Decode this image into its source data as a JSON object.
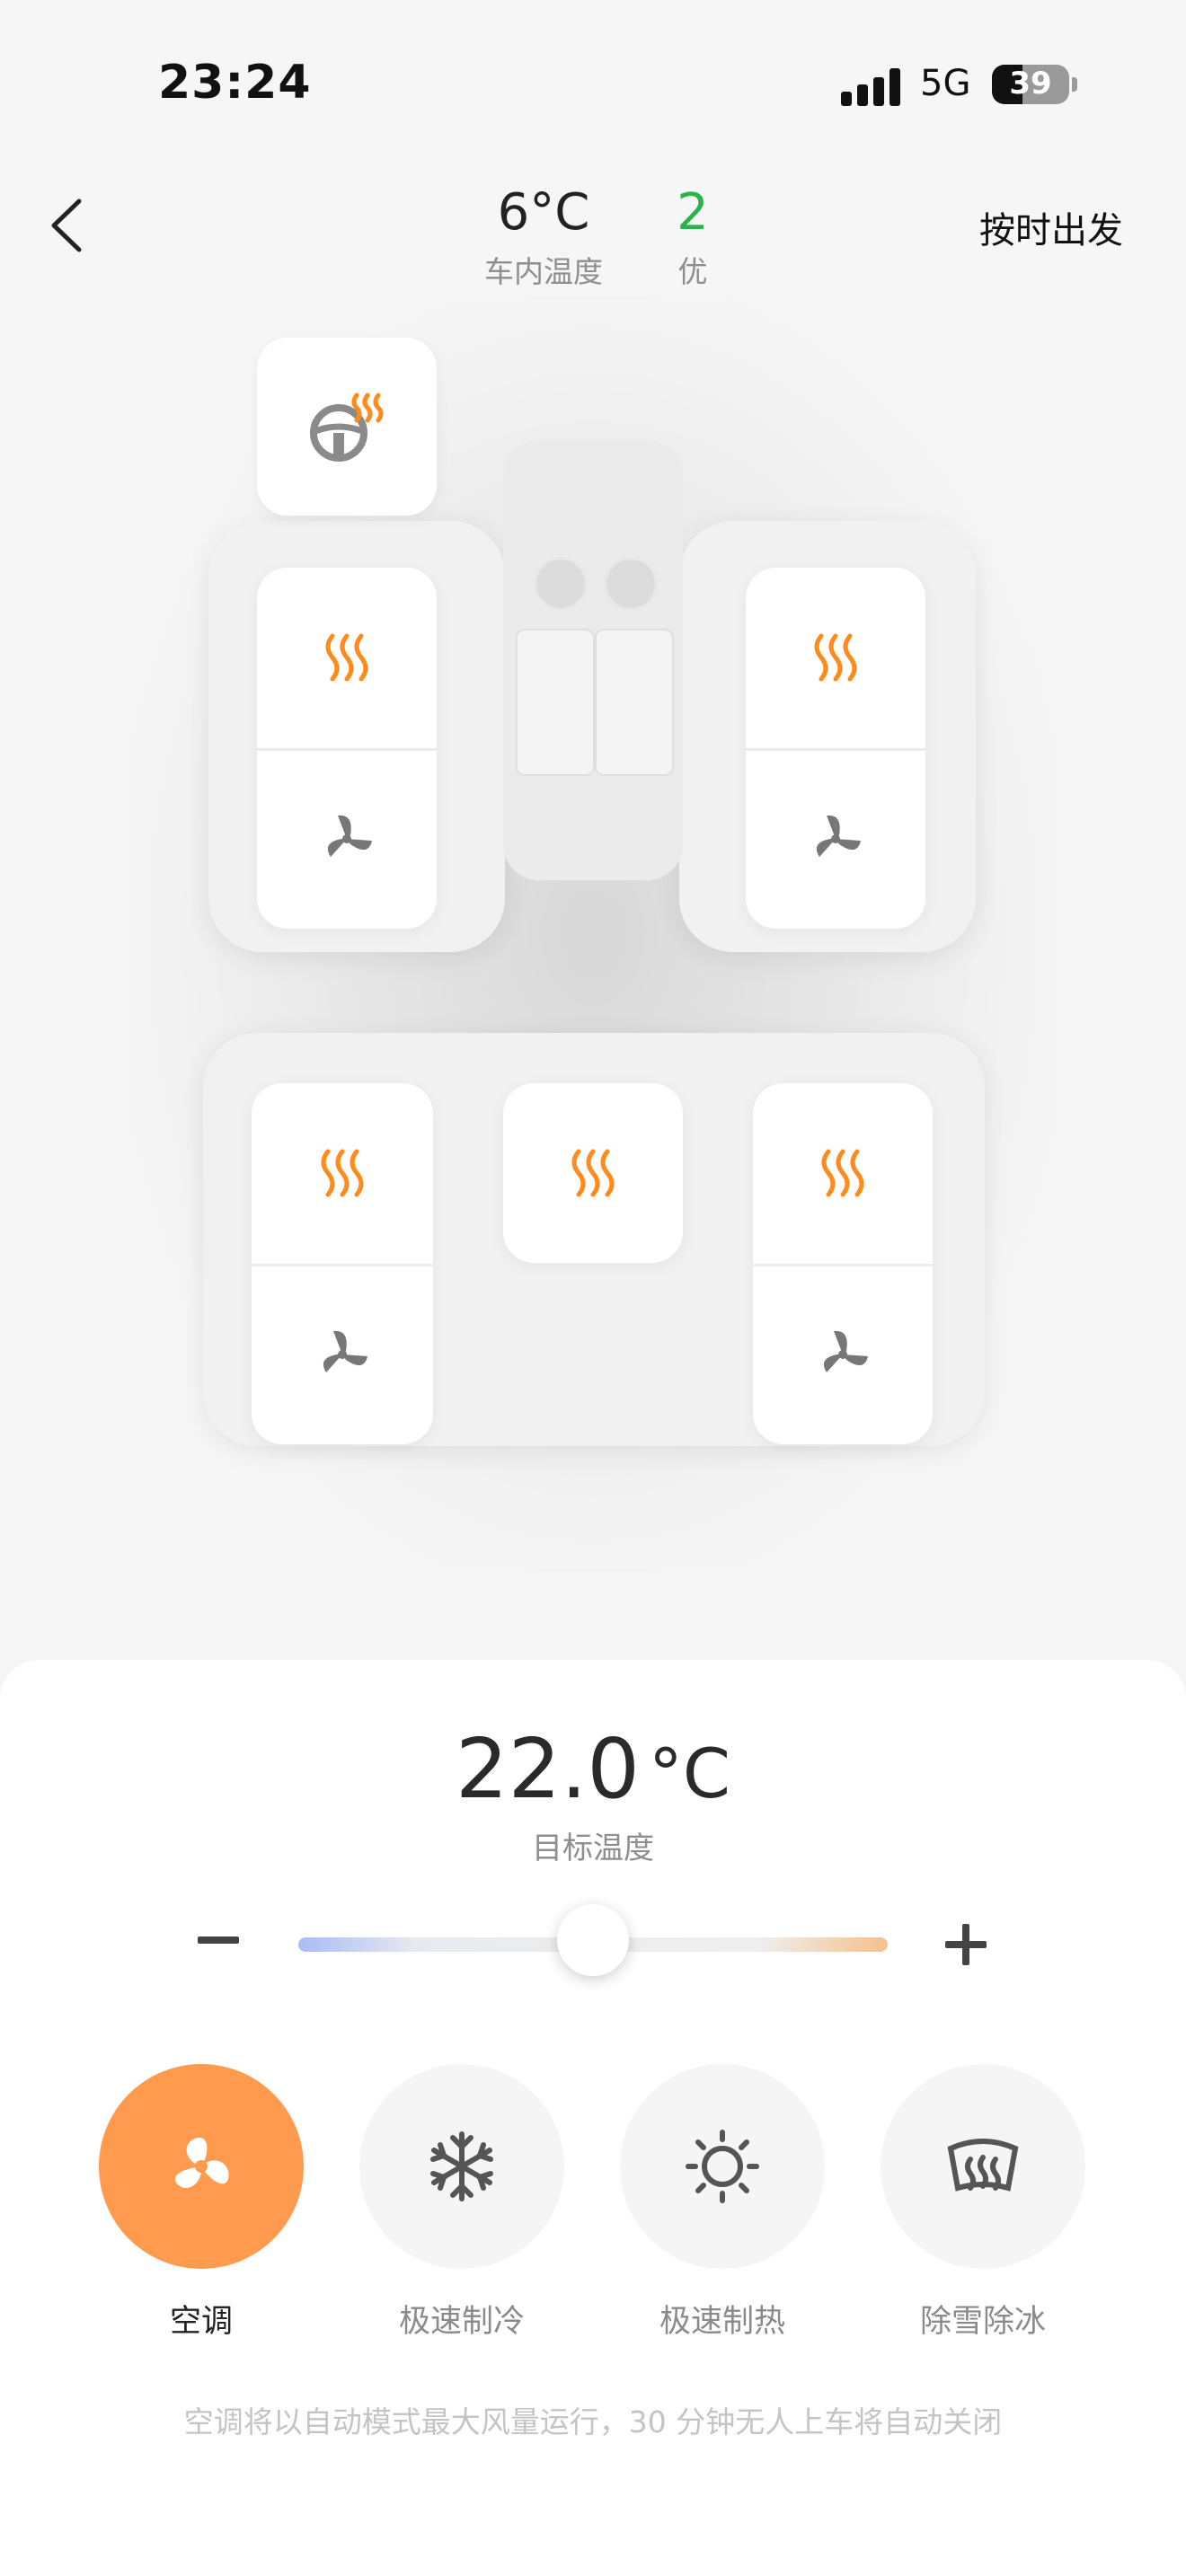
{
  "status_bar": {
    "time": "23:24",
    "network": "5G",
    "battery": "39",
    "battery_level": 0.39
  },
  "header": {
    "inner_temp": "6°C",
    "inner_temp_label": "车内温度",
    "air_quality_value": "2",
    "air_quality_label": "优",
    "schedule_label": "按时出发"
  },
  "seats": {
    "steering_wheel_heat": "steering-heat-icon",
    "front_left": [
      "heat-icon",
      "fan-icon"
    ],
    "front_right": [
      "heat-icon",
      "fan-icon"
    ],
    "rear_left": [
      "heat-icon",
      "fan-icon"
    ],
    "rear_middle": [
      "heat-icon"
    ],
    "rear_right": [
      "heat-icon",
      "fan-icon"
    ]
  },
  "climate": {
    "target_temp": "22.0",
    "unit": "°C",
    "target_label": "目标温度",
    "slider_level": 0.5
  },
  "modes": [
    {
      "label": "空调",
      "icon": "ac-fan-icon",
      "active": true
    },
    {
      "label": "极速制冷",
      "icon": "snowflake-icon",
      "active": false
    },
    {
      "label": "极速制热",
      "icon": "sun-icon",
      "active": false
    },
    {
      "label": "除雪除冰",
      "icon": "defrost-icon",
      "active": false
    }
  ],
  "hint": "空调将以自动模式最大风量运行，30 分钟无人上车将自动关闭",
  "colors": {
    "accent": "#ff9a4f",
    "heat": "#ff8c1a",
    "good": "#2bb34b"
  }
}
